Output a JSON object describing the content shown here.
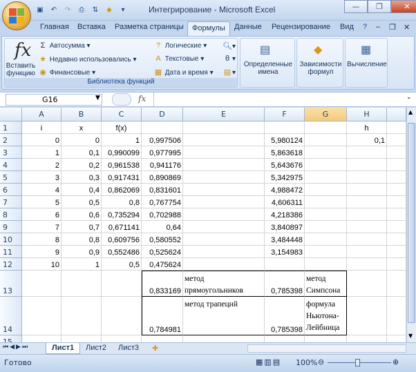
{
  "app": {
    "title": "Интегрирование - Microsoft Excel",
    "window_controls": {
      "minimize": "—",
      "restore": "❐",
      "close": "✕"
    }
  },
  "quick_access": [
    "save-icon",
    "undo-icon",
    "redo-icon",
    "print-preview-icon",
    "sort-icon",
    "paint-icon"
  ],
  "ribbon": {
    "tabs": [
      "Главная",
      "Вставка",
      "Разметка страницы",
      "Формулы",
      "Данные",
      "Рецензирование",
      "Вид"
    ],
    "active_tab": "Формулы",
    "function_library": {
      "insert_function": "Вставить функцию",
      "autosum": "Автосумма",
      "recent": "Недавно использовались",
      "financial": "Финансовые",
      "logical": "Логические",
      "text": "Текстовые",
      "datetime": "Дата и время",
      "label": "Библиотека функций"
    },
    "defined_names": "Определенные имена",
    "formula_auditing": "Зависимости формул",
    "calculation": "Вычисление"
  },
  "formula_bar": {
    "name_box": "G16",
    "fx": "fx",
    "formula": ""
  },
  "columns": [
    "A",
    "B",
    "C",
    "D",
    "E",
    "F",
    "G",
    "H"
  ],
  "rows": [
    {
      "n": "1",
      "A": "i",
      "B": "x",
      "C": "f(x)",
      "D": "",
      "E": "",
      "F": "",
      "G": "",
      "H": "h"
    },
    {
      "n": "2",
      "A": "0",
      "B": "0",
      "C": "1",
      "D": "0,997506",
      "E": "",
      "F": "5,980124",
      "G": "",
      "H": "0,1"
    },
    {
      "n": "3",
      "A": "1",
      "B": "0,1",
      "C": "0,990099",
      "D": "0,977995",
      "E": "",
      "F": "5,863618",
      "G": "",
      "H": ""
    },
    {
      "n": "4",
      "A": "2",
      "B": "0,2",
      "C": "0,961538",
      "D": "0,941176",
      "E": "",
      "F": "5,643676",
      "G": "",
      "H": ""
    },
    {
      "n": "5",
      "A": "3",
      "B": "0,3",
      "C": "0,917431",
      "D": "0,890869",
      "E": "",
      "F": "5,342975",
      "G": "",
      "H": ""
    },
    {
      "n": "6",
      "A": "4",
      "B": "0,4",
      "C": "0,862069",
      "D": "0,831601",
      "E": "",
      "F": "4,988472",
      "G": "",
      "H": ""
    },
    {
      "n": "7",
      "A": "5",
      "B": "0,5",
      "C": "0,8",
      "D": "0,767754",
      "E": "",
      "F": "4,606311",
      "G": "",
      "H": ""
    },
    {
      "n": "8",
      "A": "6",
      "B": "0,6",
      "C": "0,735294",
      "D": "0,702988",
      "E": "",
      "F": "4,218386",
      "G": "",
      "H": ""
    },
    {
      "n": "9",
      "A": "7",
      "B": "0,7",
      "C": "0,671141",
      "D": "0,64",
      "E": "",
      "F": "3,840897",
      "G": "",
      "H": ""
    },
    {
      "n": "10",
      "A": "8",
      "B": "0,8",
      "C": "0,609756",
      "D": "0,580552",
      "E": "",
      "F": "3,484448",
      "G": "",
      "H": ""
    },
    {
      "n": "11",
      "A": "9",
      "B": "0,9",
      "C": "0,552486",
      "D": "0,525624",
      "E": "",
      "F": "3,154983",
      "G": "",
      "H": ""
    },
    {
      "n": "12",
      "A": "10",
      "B": "1",
      "C": "0,5",
      "D": "0,475624",
      "E": "",
      "F": "",
      "G": "",
      "H": ""
    },
    {
      "n": "13",
      "A": "",
      "B": "",
      "C": "",
      "D": "0,833169",
      "E": "метод прямоугольников",
      "F": "0,785398",
      "G": "метод Симпсона",
      "H": ""
    },
    {
      "n": "14",
      "A": "",
      "B": "",
      "C": "",
      "D": "0,784981",
      "E": "метод трапеций",
      "F": "0,785398",
      "G": "формула Ньютона-Лейбница",
      "H": ""
    },
    {
      "n": "15",
      "A": "",
      "B": "",
      "C": "",
      "D": "",
      "E": "",
      "F": "",
      "G": "",
      "H": ""
    }
  ],
  "sheets": [
    "Лист1",
    "Лист2",
    "Лист3"
  ],
  "active_sheet": "Лист1",
  "status": {
    "ready": "Готово",
    "zoom": "100%"
  },
  "colors": {
    "ribbon": "#dfe9f5",
    "header": "#dde8f6",
    "selected_col": "#f4c97b"
  }
}
